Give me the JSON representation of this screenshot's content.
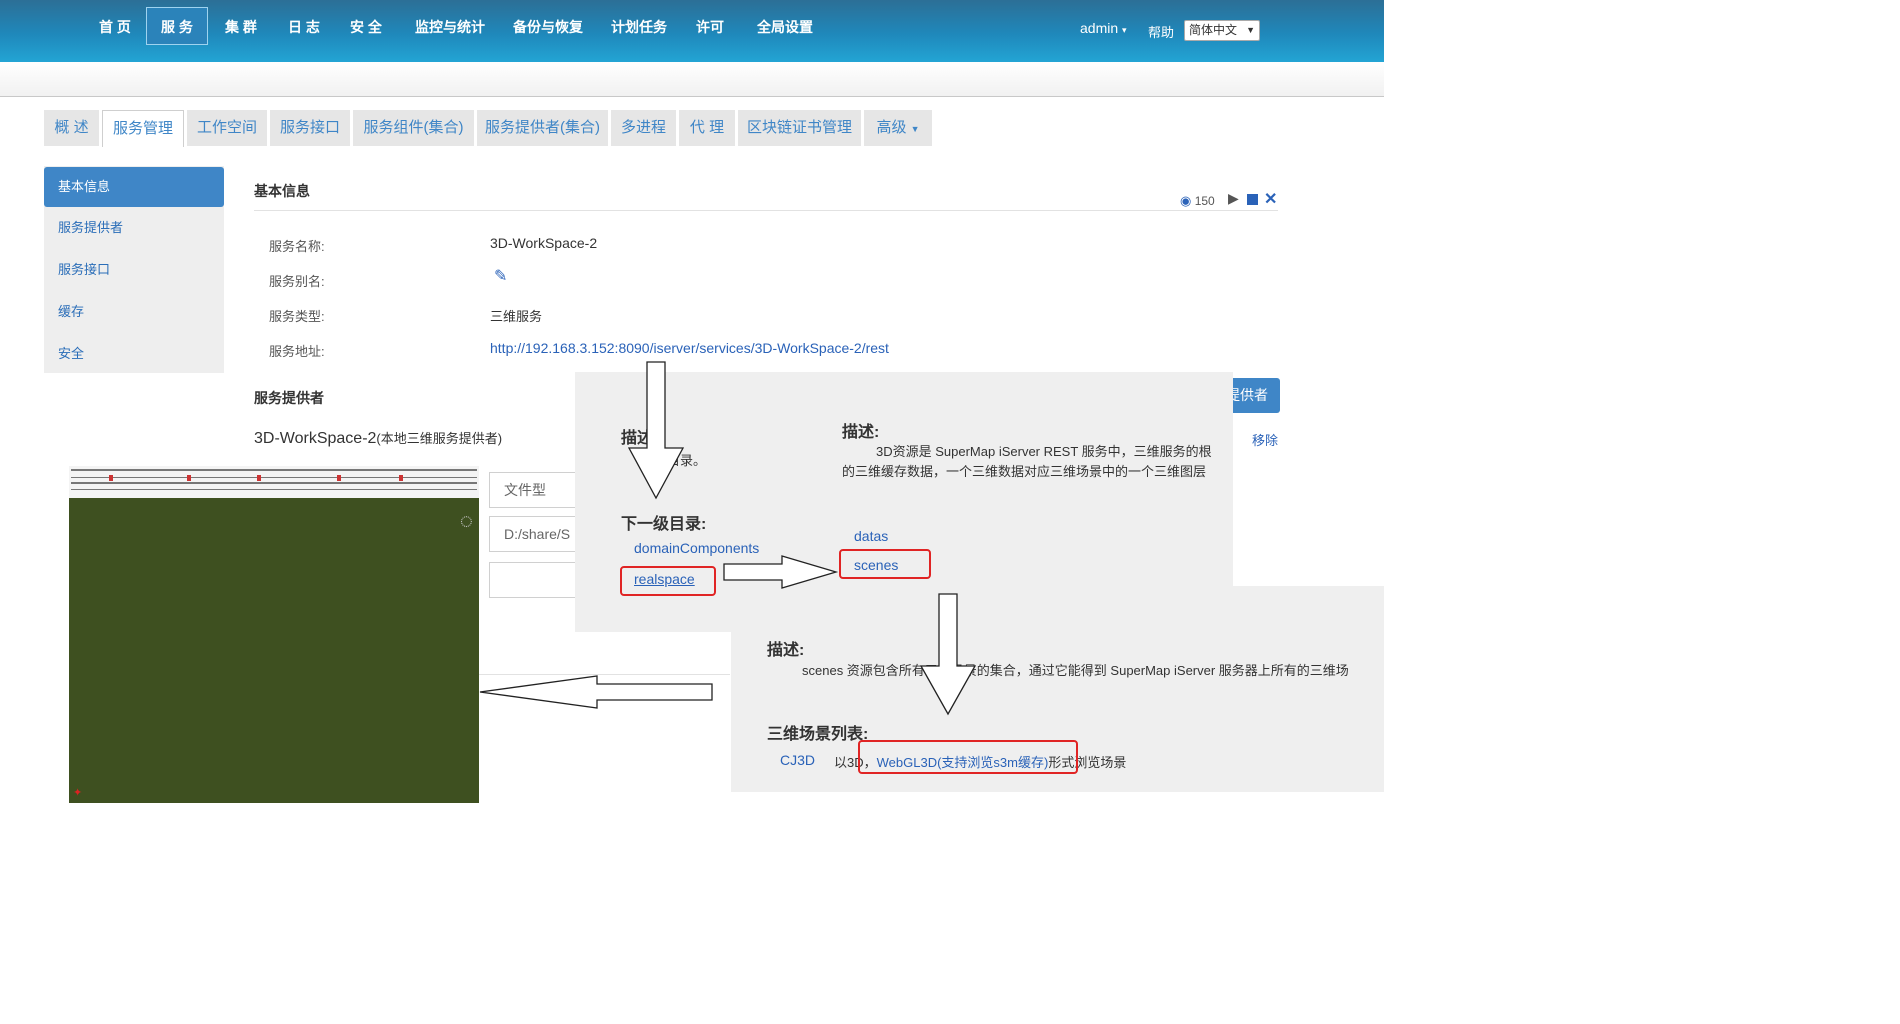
{
  "nav": {
    "items": [
      "首 页",
      "服 务",
      "集 群",
      "日 志",
      "安 全",
      "监控与统计",
      "备份与恢复",
      "计划任务",
      "许可",
      "全局设置"
    ],
    "user": "admin",
    "help": "帮助",
    "language": "简体中文"
  },
  "tabs": [
    "概 述",
    "服务管理",
    "工作空间",
    "服务接口",
    "服务组件(集合)",
    "服务提供者(集合)",
    "多进程",
    "代 理",
    "区块链证书管理",
    "高级"
  ],
  "sidebar": [
    "基本信息",
    "服务提供者",
    "服务接口",
    "缓存",
    "安全"
  ],
  "basic": {
    "title": "基本信息",
    "views": "150",
    "name_label": "服务名称:",
    "name": "3D-WorkSpace-2",
    "alias_label": "服务别名:",
    "type_label": "服务类型:",
    "type": "三维服务",
    "url_label": "服务地址:",
    "url": "http://192.168.3.152:8090/iserver/services/3D-WorkSpace-2/rest"
  },
  "provider": {
    "title": "服务提供者",
    "name": "3D-WorkSpace-2",
    "name_suffix": "(本地三维服务提供者)",
    "add_button": "提供者",
    "remove": "移除",
    "field1": "文件型",
    "field2": "D:/share/S"
  },
  "root_panel": {
    "desc_title": "描述:",
    "desc_text": "根目录。",
    "children_title": "下一级目录:",
    "children": [
      "domainComponents",
      "realspace"
    ]
  },
  "realspace_panel": {
    "desc_title": "描述:",
    "desc_line1": "3D资源是 SuperMap iServer REST 服务中，三维服务的根",
    "desc_line2": "的三维缓存数据，一个三维数据对应三维场景中的一个三维图层",
    "children": [
      "datas",
      "scenes"
    ]
  },
  "scenes_panel": {
    "desc_title": "描述:",
    "desc_text": "scenes 资源包含所有三维场景的集合，通过它能得到 SuperMap iServer 服务器上所有的三维场",
    "list_title": "三维场景列表:",
    "scene_name": "CJ3D",
    "text_prefix": "以3D，",
    "webgl_link": "WebGL3D(支持浏览s3m缓存)",
    "text_suffix": "形式浏览场景"
  },
  "colors": {
    "accent": "#3f86c7",
    "nav": "#1f88bb",
    "highlight": "#e02424",
    "scene_bg": "#3e5020"
  }
}
